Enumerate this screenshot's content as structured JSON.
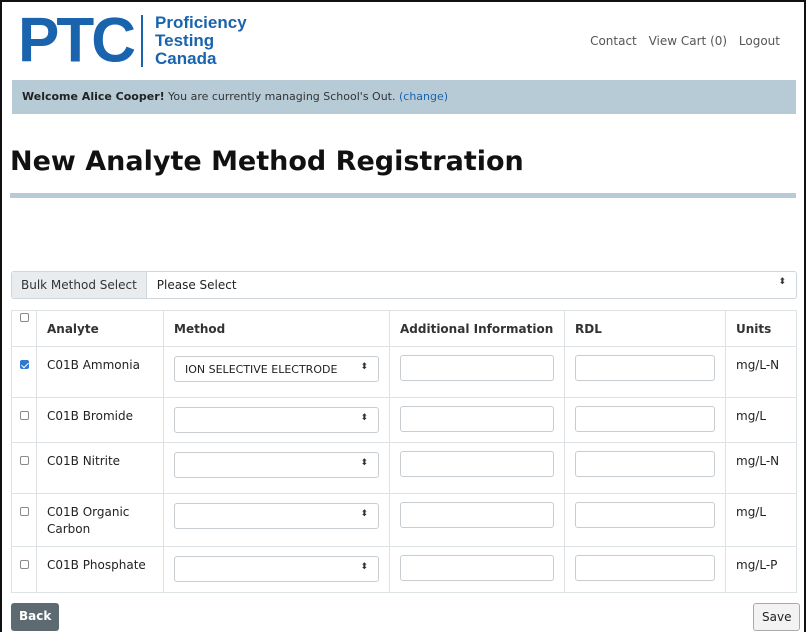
{
  "logo": {
    "mark": "PTC",
    "line1": "Proficiency",
    "line2": "Testing",
    "line3": "Canada"
  },
  "nav": {
    "contact": "Contact",
    "view_cart": "View Cart (0)",
    "logout": "Logout"
  },
  "welcome": {
    "greeting": "Welcome Alice Cooper!",
    "message": " You are currently managing School's Out. ",
    "change_link": "(change)"
  },
  "page_title": "New Analyte Method Registration",
  "bulk": {
    "label": "Bulk Method Select",
    "selected": "Please Select"
  },
  "table": {
    "headers": {
      "analyte": "Analyte",
      "method": "Method",
      "additional": "Additional Information",
      "rdl": "RDL",
      "units": "Units"
    },
    "rows": [
      {
        "checked": true,
        "analyte": "C01B Ammonia",
        "method": "ION SELECTIVE ELECTRODE",
        "additional": "",
        "rdl": "",
        "units": "mg/L-N"
      },
      {
        "checked": false,
        "analyte": "C01B Bromide",
        "method": "",
        "additional": "",
        "rdl": "",
        "units": "mg/L"
      },
      {
        "checked": false,
        "analyte": "C01B Nitrite",
        "method": "",
        "additional": "",
        "rdl": "",
        "units": "mg/L-N"
      },
      {
        "checked": false,
        "analyte": "C01B Organic Carbon",
        "method": "",
        "additional": "",
        "rdl": "",
        "units": "mg/L"
      },
      {
        "checked": false,
        "analyte": "C01B Phosphate",
        "method": "",
        "additional": "",
        "rdl": "",
        "units": "mg/L-P"
      }
    ]
  },
  "buttons": {
    "back": "Back",
    "save": "Save"
  },
  "icons": {
    "select_chevron": "chevron-updown-icon",
    "checkbox": "checkbox-icon"
  },
  "colors": {
    "brand": "#1a64ad",
    "banner": "#b7cbd6",
    "check": "#2f79d0",
    "back_button": "#5d6a72"
  }
}
